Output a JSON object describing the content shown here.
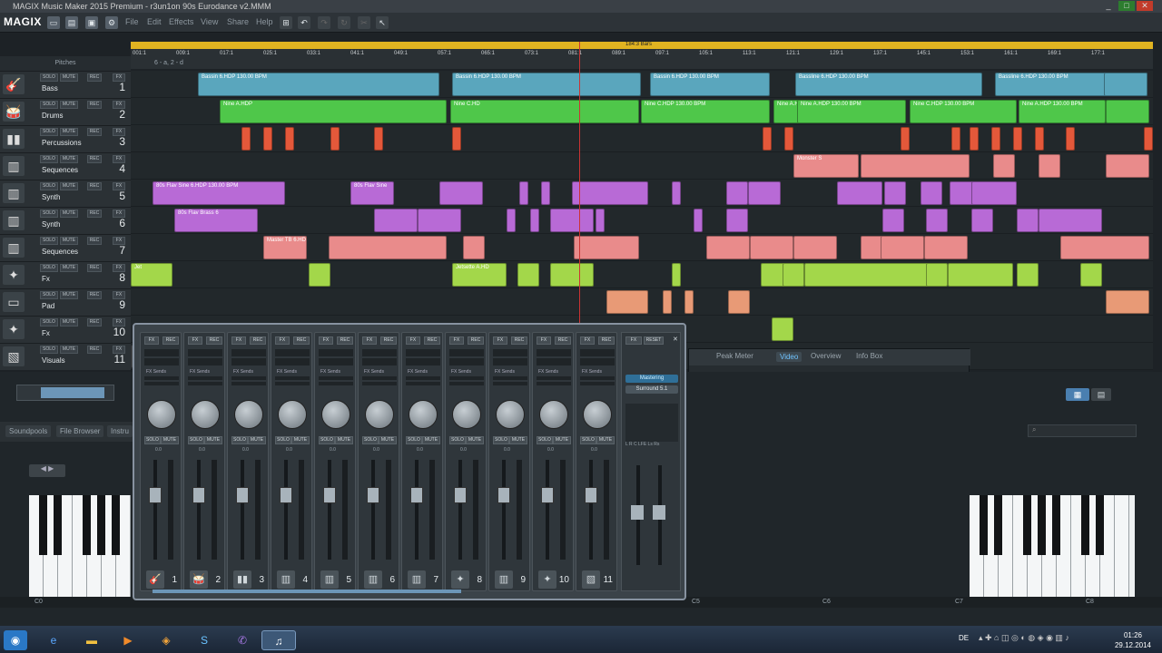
{
  "window": {
    "title": "MAGIX Music Maker 2015 Premium - r3un1on 90s Eurodance v2.MMM",
    "controls": [
      "_",
      "□",
      "✕"
    ]
  },
  "menubar": {
    "logo": "MAGIX",
    "items": [
      "File",
      "Edit",
      "Effects",
      "View",
      "Share",
      "Help"
    ]
  },
  "toolbar": {
    "icons": [
      "new-icon",
      "open-icon",
      "save-icon",
      "settings-icon"
    ]
  },
  "ruler": {
    "position": "184:3 Bars",
    "marks": [
      "001:1",
      "009:1",
      "017:1",
      "025:1",
      "033:1",
      "041:1",
      "049:1",
      "057:1",
      "065:1",
      "073:1",
      "081:1",
      "089:1",
      "097:1",
      "105:1",
      "113:1",
      "121:1",
      "129:1",
      "137:1",
      "145:1",
      "153:1",
      "161:1",
      "169:1",
      "177:1"
    ],
    "sub": "6 - a, 2 - d"
  },
  "tracks_header": {
    "pitches_label": "Pitches",
    "button_labels": [
      "SOLO",
      "MUTE",
      "REC",
      "FX"
    ]
  },
  "tracks": [
    {
      "name": "Bass",
      "num": "1",
      "icon": "bass-icon",
      "color": "#5aa6bd"
    },
    {
      "name": "Drums",
      "num": "2",
      "icon": "drums-icon",
      "color": "#4fc74a"
    },
    {
      "name": "Percussions",
      "num": "3",
      "icon": "bongos-icon",
      "color": "#e4583a"
    },
    {
      "name": "Sequences",
      "num": "4",
      "icon": "keys-icon",
      "color": "#e98b8b"
    },
    {
      "name": "Synth",
      "num": "5",
      "icon": "keys-icon",
      "color": "#b86ad6"
    },
    {
      "name": "Synth",
      "num": "6",
      "icon": "keys-icon",
      "color": "#b86ad6"
    },
    {
      "name": "Sequences",
      "num": "7",
      "icon": "keys-icon",
      "color": "#e98b8b"
    },
    {
      "name": "Fx",
      "num": "8",
      "icon": "fx-icon",
      "color": "#a3d74a"
    },
    {
      "name": "Pad",
      "num": "9",
      "icon": "pad-icon",
      "color": "#e89a76"
    },
    {
      "name": "Fx",
      "num": "10",
      "icon": "fx-icon",
      "color": "#a3d74a"
    },
    {
      "name": "Visuals",
      "num": "11",
      "icon": "visuals-icon",
      "color": "#d96a2a"
    }
  ],
  "clips": {
    "bass": [
      "Bassin 6.HDP  130.00 BPM",
      "Bassin 6.HDP  130.00 BPM",
      "Bassin 6.HDP  130.00 BPM",
      "Bassline 6.HDP  130.00 BPM",
      "Bassline 6.HDP  130.00 BPM"
    ],
    "drums": [
      "Nine A.HDP",
      "Nine C.HD",
      "Nine C.HDP  130.00 BPM",
      "Nine A.HDP  130.00 BPM",
      "Nine A.HDP  130.00 BPM",
      "Nine C.HDP  130.00 BPM",
      "Nine A.HDP  130.00 BPM"
    ],
    "seq4": [
      "Monster S"
    ],
    "synth5": [
      "80s Flav Sine 6.HDP  130.00 BPM",
      "80s Flav Sine"
    ],
    "synth6": [
      "80s Flav Brass 6"
    ],
    "seq7": [
      "Master TB 6.HDP  R/Delay"
    ],
    "fx8": [
      "Jet",
      "Rim Sh",
      "Jetsette  A.HD",
      "Power_Bass 6.HDP"
    ]
  },
  "mixer": {
    "strip_buttons": [
      "FX",
      "REC"
    ],
    "sends_label": "FX Sends",
    "solo_label": "SOLO",
    "mute_label": "MUTE",
    "db_label": "0.0",
    "channels": [
      "1",
      "2",
      "3",
      "4",
      "5",
      "6",
      "7",
      "8",
      "9",
      "10",
      "11"
    ],
    "master": {
      "fx": "FX",
      "reset": "RESET",
      "mastering": "Mastering",
      "surround": "Surround 5.1",
      "lfe": "L  R  C  LFE  Ls  Rs"
    }
  },
  "rightpanel": {
    "tabs": [
      "Peak Meter",
      "Video",
      "Overview",
      "Info Box"
    ],
    "active": "Video"
  },
  "bottom": {
    "tabs": [
      "Soundpools",
      "File Browser",
      "Instru"
    ],
    "keys": [
      "C0",
      "C5",
      "C6",
      "C7",
      "C8"
    ]
  },
  "taskbar": {
    "apps": [
      "start-orb-icon",
      "ie-icon",
      "explorer-icon",
      "media-icon",
      "outlook-icon",
      "skype-icon",
      "viber-icon",
      "magix-icon"
    ],
    "lang": "DE",
    "time": "01:26",
    "date": "29.12.2014"
  }
}
